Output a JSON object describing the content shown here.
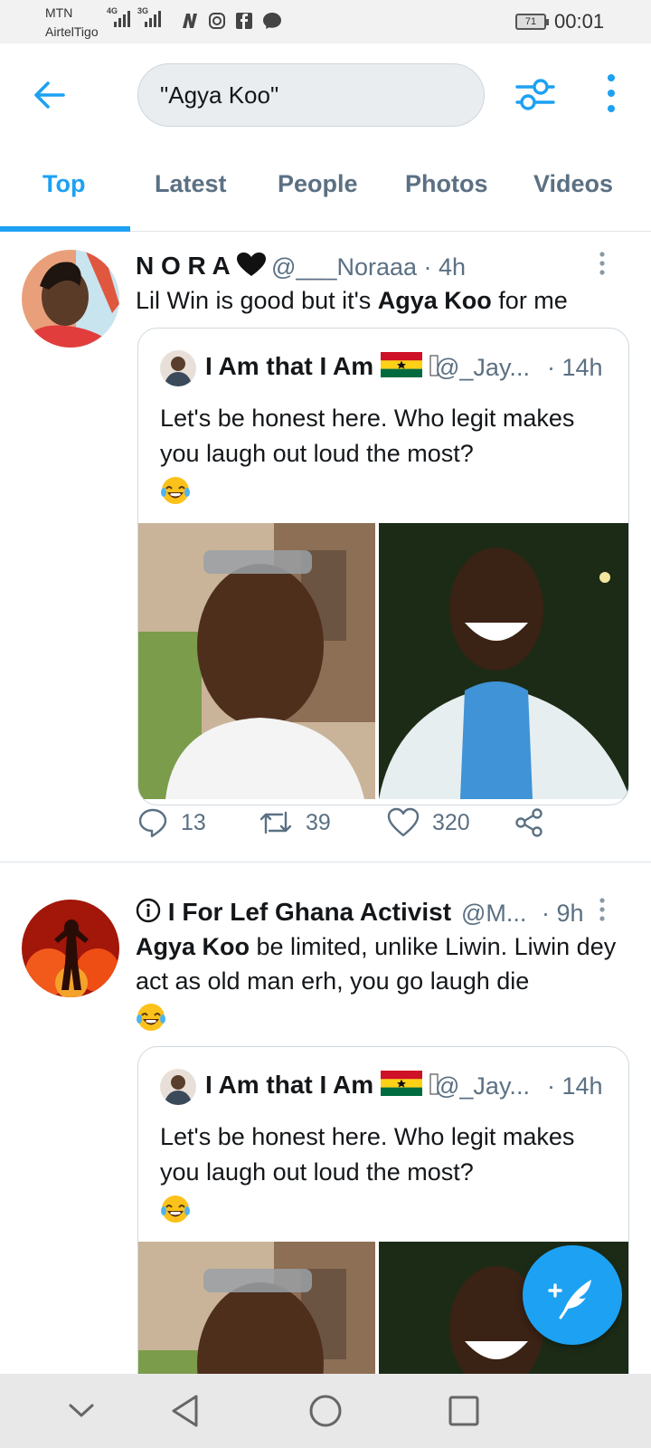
{
  "status_bar": {
    "carrier1": "MTN",
    "carrier2": "AirtelTigo",
    "net1": "4G",
    "net2": "3G",
    "battery": "71",
    "time": "00:01"
  },
  "search": {
    "query": "\"Agya Koo\""
  },
  "tabs": [
    {
      "label": "Top",
      "active": true
    },
    {
      "label": "Latest"
    },
    {
      "label": "People"
    },
    {
      "label": "Photos"
    },
    {
      "label": "Videos"
    }
  ],
  "tweets": [
    {
      "name": "N O R A",
      "handle": "@___Noraaa · 4h",
      "text_pre": "Lil Win is good but it's ",
      "text_bold": "Agya Koo",
      "text_post": " for me",
      "quote": {
        "name": "I Am that I Am",
        "handle": "@_Jay...",
        "time": "· 14h",
        "text": "Let's be honest here. Who legit makes you laugh out loud the most?"
      },
      "replies": "13",
      "retweets": "39",
      "likes": "320"
    },
    {
      "name": "I For Lef Ghana Activist",
      "handle": "@M...",
      "time": "· 9h",
      "text_bold": "Agya Koo",
      "text_post": " be limited, unlike Liwin. Liwin dey act as old man erh, you go laugh die",
      "quote": {
        "name": "I Am that I Am",
        "handle": "@_Jay...",
        "time": "· 14h",
        "text": "Let's be honest here. Who legit makes you laugh out loud the most?"
      }
    }
  ],
  "colors": {
    "accent": "#1da1f2",
    "secondary_text": "#5b7083"
  }
}
